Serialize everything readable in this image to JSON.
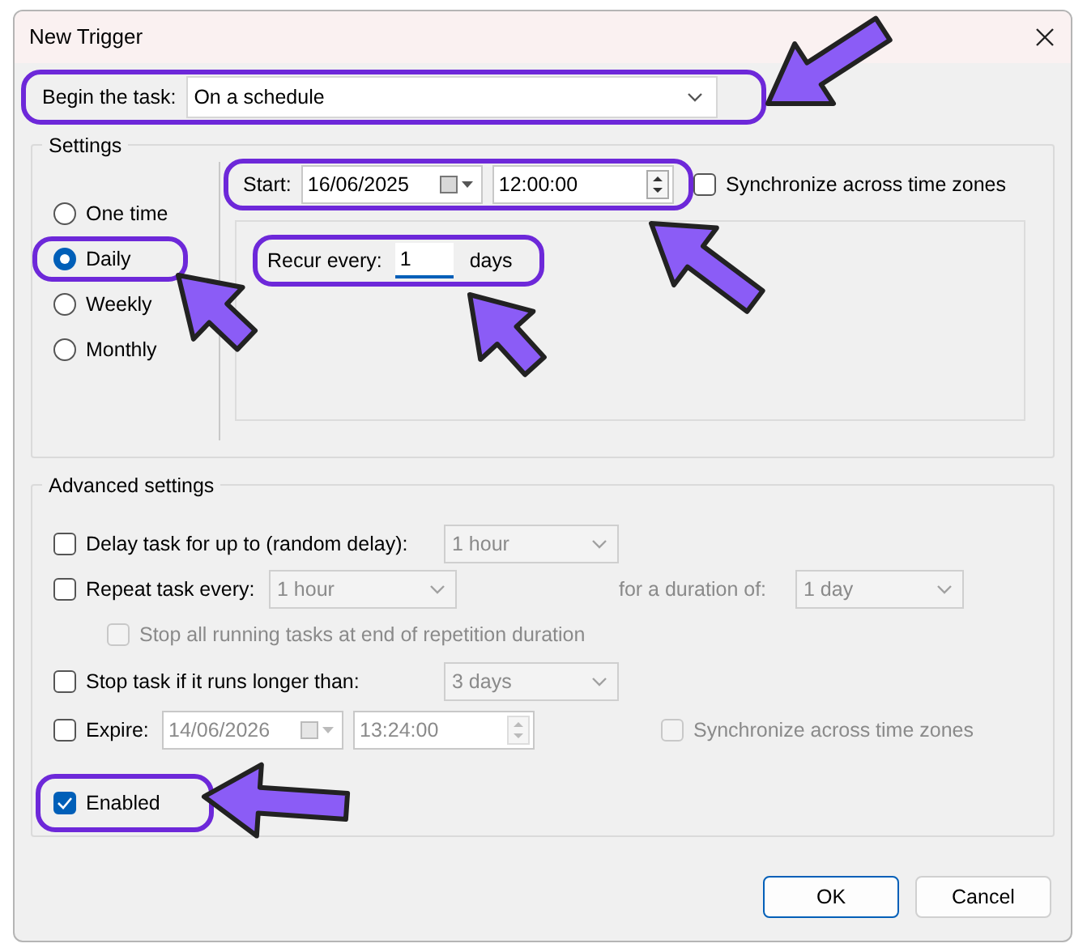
{
  "window": {
    "title": "New Trigger"
  },
  "begin_task": {
    "label": "Begin the task:",
    "value": "On a schedule",
    "highlighted": true
  },
  "settings": {
    "title": "Settings",
    "schedule_options": [
      {
        "label": "One time",
        "selected": false,
        "highlighted": false
      },
      {
        "label": "Daily",
        "selected": true,
        "highlighted": true
      },
      {
        "label": "Weekly",
        "selected": false,
        "highlighted": false
      },
      {
        "label": "Monthly",
        "selected": false,
        "highlighted": false
      }
    ],
    "start": {
      "label": "Start:",
      "date": "16/06/2025",
      "time": "12:00:00",
      "highlighted": true
    },
    "sync_time_zones": {
      "label": "Synchronize across time zones",
      "checked": false
    },
    "recur": {
      "label": "Recur every:",
      "value": "1",
      "unit": "days",
      "highlighted": true
    }
  },
  "advanced": {
    "title": "Advanced settings",
    "delay": {
      "label": "Delay task for up to (random delay):",
      "checked": false,
      "value": "1 hour"
    },
    "repeat": {
      "label": "Repeat task every:",
      "checked": false,
      "value": "1 hour",
      "duration_label": "for a duration of:",
      "duration_value": "1 day"
    },
    "stop_all": {
      "label": "Stop all running tasks at end of repetition duration",
      "checked": false
    },
    "stop_task": {
      "label": "Stop task if it runs longer than:",
      "checked": false,
      "value": "3 days"
    },
    "expire": {
      "label": "Expire:",
      "checked": false,
      "date": "14/06/2026",
      "time": "13:24:00",
      "sync_label": "Synchronize across time zones",
      "sync_checked": false
    },
    "enabled": {
      "label": "Enabled",
      "checked": true,
      "highlighted": true
    }
  },
  "buttons": [
    {
      "label": "OK",
      "default": true
    },
    {
      "label": "Cancel",
      "default": false
    }
  ]
}
